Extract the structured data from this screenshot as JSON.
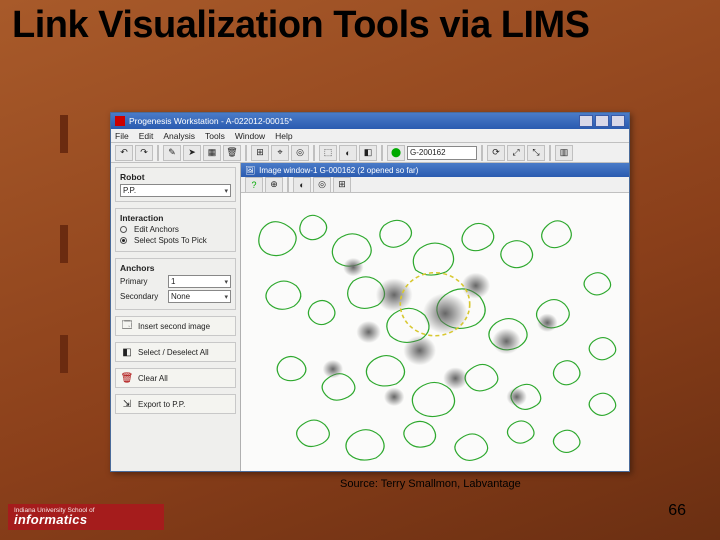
{
  "slide": {
    "title": "Link Visualization Tools via LIMS",
    "source": "Source: Terry Smallmon, Labvantage",
    "page_number": "66"
  },
  "logo": {
    "top": "Indiana University School of",
    "main": "informatics"
  },
  "app": {
    "title": "Progenesis Workstation - A-022012-00015*",
    "menu": {
      "file": "File",
      "edit": "Edit",
      "analysis": "Analysis",
      "tools": "Tools",
      "window": "Window",
      "help": "Help"
    },
    "toolbar": {
      "id_value": "G-200162",
      "icons": [
        "↶",
        "↷",
        "✎",
        "➤",
        "▦",
        "🗑",
        "⊞",
        "⌖",
        "◎",
        "⬚",
        "◐",
        "◧",
        "⟳",
        "⤢",
        "⤡",
        "▥",
        "▤",
        "⌫",
        "✓"
      ]
    },
    "inner_window_title": "Image window-1 G-000162 (2 opened so far)",
    "sidebar": {
      "robot_label": "Robot",
      "robot_value": "P.P.",
      "interaction_label": "Interaction",
      "radio_edit": "Edit Anchors",
      "radio_select": "Select Spots To Pick",
      "anchors_label": "Anchors",
      "primary_label": "Primary",
      "primary_value": "1",
      "secondary_label": "Secondary",
      "secondary_value": "None",
      "btn_insert": "Insert second image",
      "btn_select_all": "Select / Deselect All",
      "btn_clear": "Clear All",
      "btn_export": "Export to P.P."
    },
    "icons": {
      "insert": "🗔",
      "select_all": "◧",
      "clear": "🗑",
      "export": "⇲"
    }
  }
}
